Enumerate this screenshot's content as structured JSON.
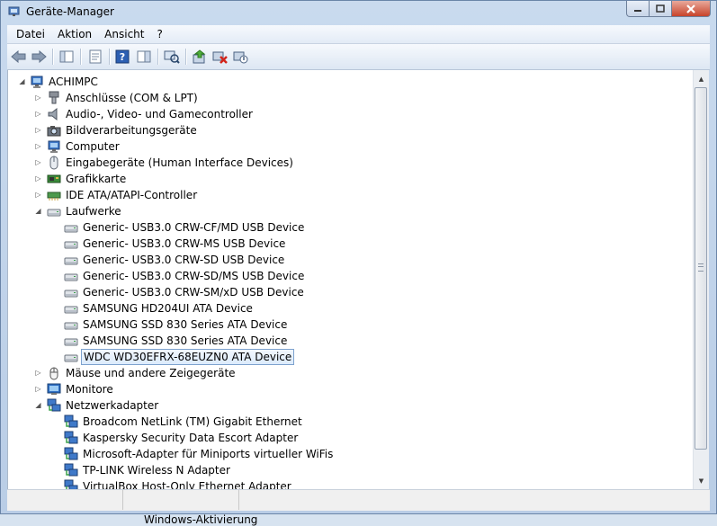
{
  "window": {
    "title": "Geräte-Manager"
  },
  "menu": [
    "Datei",
    "Aktion",
    "Ansicht",
    "?"
  ],
  "toolbar": [
    "back-icon",
    "forward-icon",
    "show-hide-console-tree-icon",
    "properties-icon",
    "help-icon",
    "action-pane-icon",
    "scan-hardware-icon",
    "update-driver-icon",
    "uninstall-icon",
    "enable-device-icon"
  ],
  "tree": {
    "root": "ACHIMPC",
    "items": [
      {
        "label": "Anschlüsse (COM & LPT)",
        "icon": "port-icon",
        "level": 1,
        "expander": "collapsed"
      },
      {
        "label": "Audio-, Video- und Gamecontroller",
        "icon": "speaker-icon",
        "level": 1,
        "expander": "collapsed"
      },
      {
        "label": "Bildverarbeitungsgeräte",
        "icon": "camera-icon",
        "level": 1,
        "expander": "collapsed"
      },
      {
        "label": "Computer",
        "icon": "computer-icon",
        "level": 1,
        "expander": "collapsed"
      },
      {
        "label": "Eingabegeräte (Human Interface Devices)",
        "icon": "hid-icon",
        "level": 1,
        "expander": "collapsed"
      },
      {
        "label": "Grafikkarte",
        "icon": "display-adapter-icon",
        "level": 1,
        "expander": "collapsed"
      },
      {
        "label": "IDE ATA/ATAPI-Controller",
        "icon": "ide-controller-icon",
        "level": 1,
        "expander": "collapsed"
      },
      {
        "label": "Laufwerke",
        "icon": "drive-icon",
        "level": 1,
        "expander": "expanded"
      },
      {
        "label": "Generic- USB3.0 CRW-CF/MD USB Device",
        "icon": "drive-icon",
        "level": 2
      },
      {
        "label": "Generic- USB3.0 CRW-MS USB Device",
        "icon": "drive-icon",
        "level": 2
      },
      {
        "label": "Generic- USB3.0 CRW-SD USB Device",
        "icon": "drive-icon",
        "level": 2
      },
      {
        "label": "Generic- USB3.0 CRW-SD/MS USB Device",
        "icon": "drive-icon",
        "level": 2
      },
      {
        "label": "Generic- USB3.0 CRW-SM/xD USB Device",
        "icon": "drive-icon",
        "level": 2
      },
      {
        "label": "SAMSUNG HD204UI ATA Device",
        "icon": "drive-icon",
        "level": 2
      },
      {
        "label": "SAMSUNG SSD 830 Series ATA Device",
        "icon": "drive-icon",
        "level": 2
      },
      {
        "label": "SAMSUNG SSD 830 Series ATA Device",
        "icon": "drive-icon",
        "level": 2
      },
      {
        "label": "WDC WD30EFRX-68EUZN0 ATA Device",
        "icon": "drive-icon",
        "level": 2,
        "selected": true
      },
      {
        "label": "Mäuse und andere Zeigegeräte",
        "icon": "mouse-icon",
        "level": 1,
        "expander": "collapsed"
      },
      {
        "label": "Monitore",
        "icon": "monitor-icon",
        "level": 1,
        "expander": "collapsed"
      },
      {
        "label": "Netzwerkadapter",
        "icon": "network-icon",
        "level": 1,
        "expander": "expanded"
      },
      {
        "label": "Broadcom NetLink (TM) Gigabit Ethernet",
        "icon": "network-icon",
        "level": 2
      },
      {
        "label": "Kaspersky Security Data Escort Adapter",
        "icon": "network-icon",
        "level": 2
      },
      {
        "label": "Microsoft-Adapter für Miniports virtueller WiFis",
        "icon": "network-icon",
        "level": 2
      },
      {
        "label": "TP-LINK Wireless N Adapter",
        "icon": "network-icon",
        "level": 2
      },
      {
        "label": "VirtualBox Host-Only Ethernet Adapter",
        "icon": "network-icon",
        "level": 2
      }
    ]
  },
  "background_text": "Windows-Aktivierung",
  "colors": {
    "selection_border": "#7da2ce",
    "selection_fill": "#dcebfc",
    "close_button": "#c7432a"
  }
}
